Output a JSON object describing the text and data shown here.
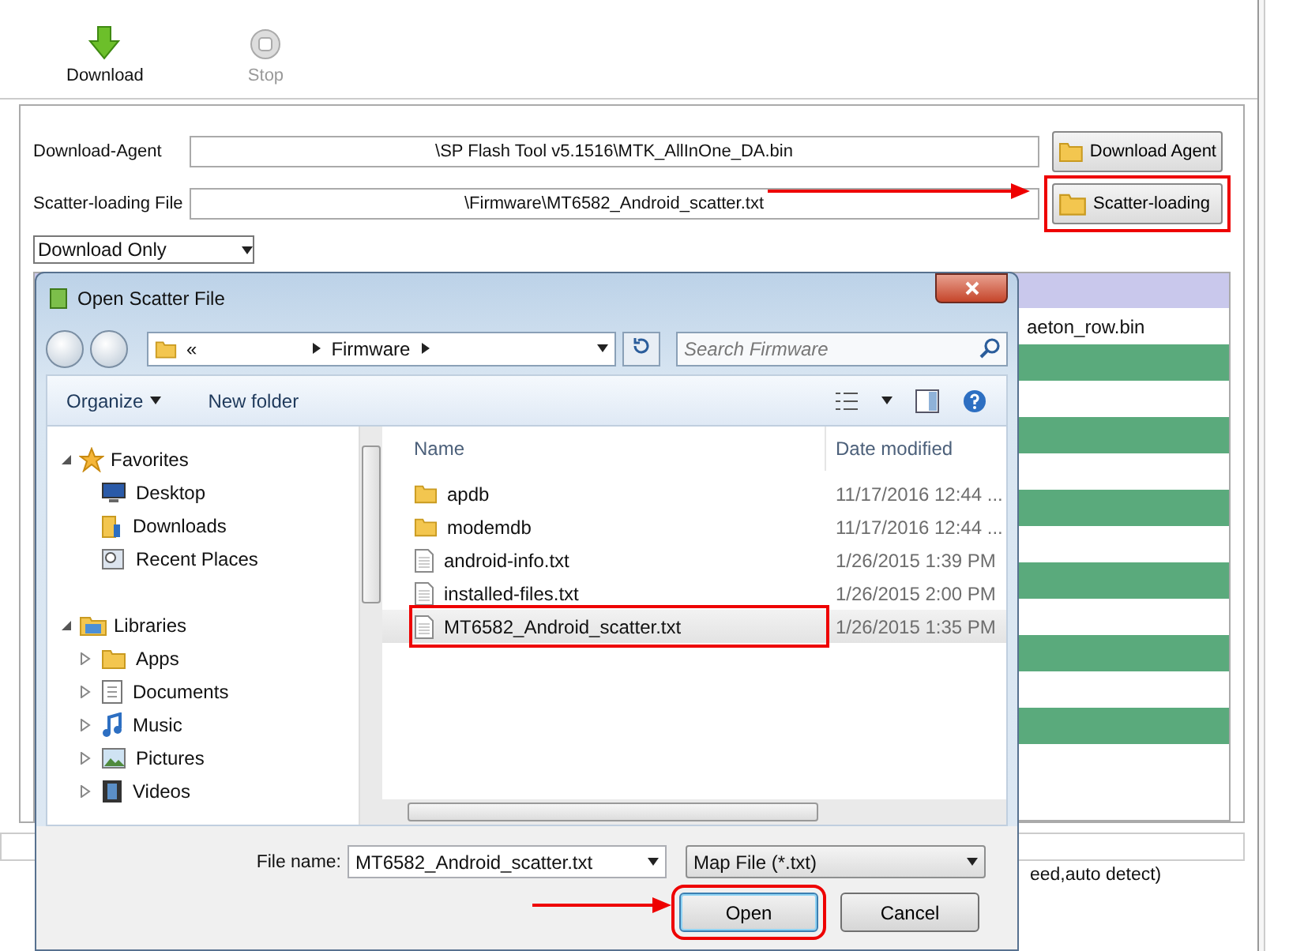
{
  "toolbar": [
    {
      "label": "Download",
      "disabled": false
    },
    {
      "label": "Stop",
      "disabled": true
    }
  ],
  "fields": [
    {
      "label": "Download-Agent",
      "value": "\\SP Flash Tool v5.1516\\MTK_AllInOne_DA.bin",
      "button": "Download Agent",
      "highlighted": false
    },
    {
      "label": "Scatter-loading File",
      "value": "\\Firmware\\MT6582_Android_scatter.txt",
      "button": "Scatter-loading",
      "highlighted": true
    }
  ],
  "mode_select": {
    "value": "Download Only"
  },
  "table": {
    "rows": [
      {
        "column_1": "aeton_row.bin"
      }
    ]
  },
  "status_bar": {
    "text": "eed,auto detect)"
  },
  "dialog": {
    "title": "Open Scatter File",
    "address": {
      "prefix": "«",
      "folder": "Firmware"
    },
    "search": {
      "placeholder": "Search Firmware"
    },
    "commands": [
      {
        "label": "Organize",
        "menu": true
      },
      {
        "label": "New folder",
        "menu": false
      }
    ],
    "nav": [
      {
        "label": "Favorites",
        "expanded": true,
        "children": [
          {
            "label": "Desktop"
          },
          {
            "label": "Downloads"
          },
          {
            "label": "Recent Places"
          }
        ]
      },
      {
        "label": "Libraries",
        "expanded": true,
        "children": [
          {
            "label": "Apps",
            "expanded": false
          },
          {
            "label": "Documents",
            "expanded": false
          },
          {
            "label": "Music",
            "expanded": false
          },
          {
            "label": "Pictures",
            "expanded": false
          },
          {
            "label": "Videos",
            "expanded": false
          }
        ]
      }
    ],
    "columns": [
      "Name",
      "Date modified"
    ],
    "files": [
      {
        "name": "apdb",
        "date": "11/17/2016 12:44 ...",
        "kind": "folder",
        "selected": false
      },
      {
        "name": "modemdb",
        "date": "11/17/2016 12:44 ...",
        "kind": "folder",
        "selected": false
      },
      {
        "name": "android-info.txt",
        "date": "1/26/2015 1:39 PM",
        "kind": "text",
        "selected": false
      },
      {
        "name": "installed-files.txt",
        "date": "1/26/2015 2:00 PM",
        "kind": "text",
        "selected": false
      },
      {
        "name": "MT6582_Android_scatter.txt",
        "date": "1/26/2015 1:35 PM",
        "kind": "text",
        "selected": true
      }
    ],
    "file_name": {
      "label": "File name:",
      "value": "MT6582_Android_scatter.txt"
    },
    "file_type": {
      "value": "Map File (*.txt)"
    },
    "buttons": [
      {
        "label": "Open",
        "default": true
      },
      {
        "label": "Cancel",
        "default": false
      }
    ]
  }
}
